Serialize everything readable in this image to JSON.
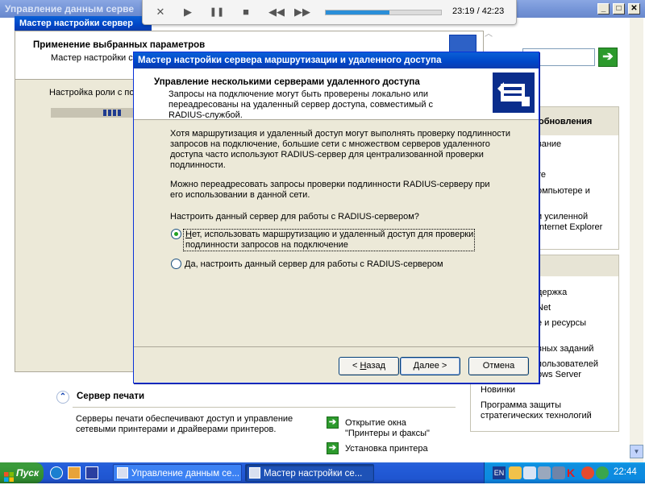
{
  "back_window": {
    "title": "Управление данным серве",
    "wizard_bar_title": "Мастер настройки сервер",
    "apply_heading": "Применение выбранных параметров",
    "apply_sub": "Мастер настройки се",
    "role_text": "Настройка роли с по",
    "updates_head": "обновления",
    "updates_items": [
      "вание",
      "те",
      "омпьютере и",
      "и усиленной",
      "Internet Explorer"
    ],
    "more_items": [
      "держка",
      "Net",
      "е и ресурсы",
      "вных заданий",
      "пользователей",
      "ows Server",
      "Новинки",
      "Программа защиты",
      "стратегических технологий"
    ],
    "print_server_title": "Сервер печати",
    "print_server_desc_1": "Серверы печати обеспечивают доступ и управление",
    "print_server_desc_2": "сетевыми принтерами и драйверами принтеров.",
    "link_open_1": "Открытие окна",
    "link_open_2": "\"Принтеры и факсы\"",
    "link_install": "Установка принтера"
  },
  "dialog": {
    "title": "Мастер настройки сервера маршрутизации и удаленного доступа",
    "header_title": "Управление несколькими серверами удаленного доступа",
    "header_sub_1": "Запросы на подключение могут быть проверены локально или",
    "header_sub_2": "переадресованы на удаленный сервер доступа, совместимый с",
    "header_sub_3": "RADIUS-службой.",
    "para1_1": "Хотя маршрутизация и удаленный доступ могут выполнять проверку подлинности",
    "para1_2": "запросов на подключение, большие сети с множеством серверов удаленного",
    "para1_3": "доступа часто используют RADIUS-сервер для централизованной проверки",
    "para1_4": "подлинности.",
    "para2_1": "Можно переадресовать запросы проверки подлинности RADIUS-серверу при",
    "para2_2": "его использовании в данной сети.",
    "question": "Настроить данный сервер для работы с RADIUS-сервером?",
    "option_no_accel": "Н",
    "option_no_rest_1": "ет, использовать маршрутизацию и удаленный доступ для проверки",
    "option_no_rest_2": "подлинности запросов на подключение",
    "option_yes_accel": "Д",
    "option_yes_rest": "а, настроить данный сервер для работы с RADIUS-сервером",
    "selected_option": "no",
    "back_prefix": "< ",
    "back_accel": "Н",
    "back_rest": "азад",
    "next_accel": "Д",
    "next_rest": "алее >",
    "cancel": "Отмена"
  },
  "media_player": {
    "time": "23:19 / 42:23",
    "progress": 0.55
  },
  "taskbar": {
    "start": "Пуск",
    "task1": "Управление данным се...",
    "task2": "Мастер настройки се...",
    "lang": "EN",
    "clock": "22:44"
  },
  "colors": {
    "xp_blue": "#0046c8",
    "dialog_face": "#ece9d8",
    "taskbar_blue": "#245edb",
    "start_green": "#3a9b3a"
  }
}
